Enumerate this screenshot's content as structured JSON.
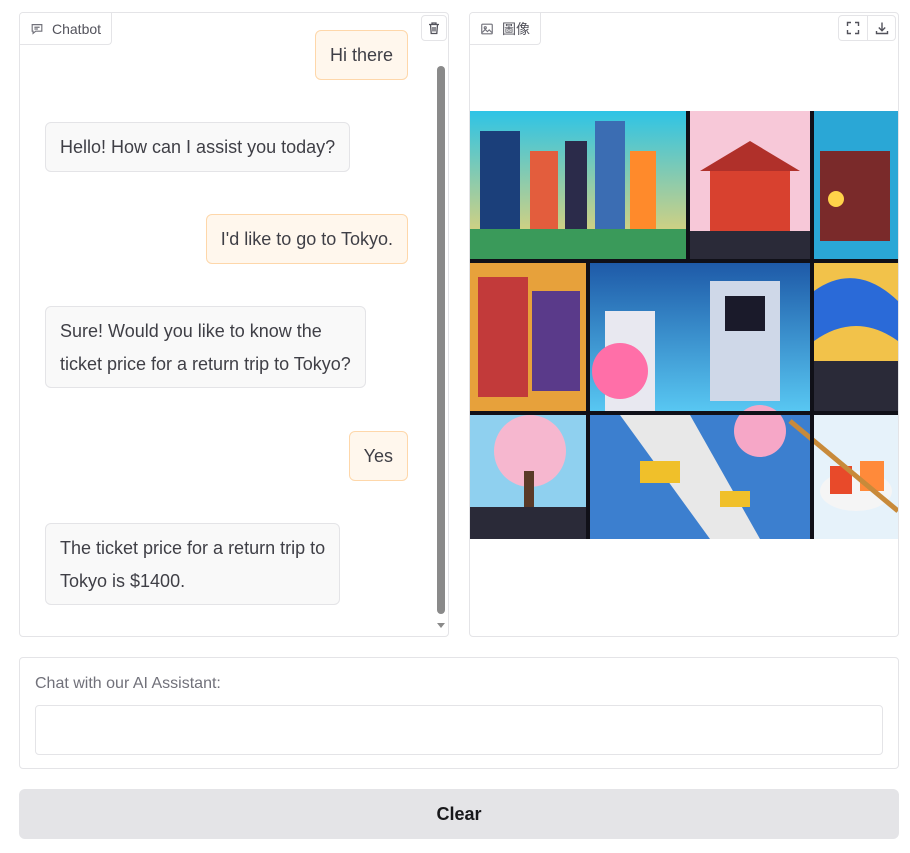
{
  "chatbot": {
    "label": "Chatbot",
    "messages": [
      {
        "role": "user",
        "text": "Hi there"
      },
      {
        "role": "bot",
        "text": "Hello! How can I assist you today?"
      },
      {
        "role": "user",
        "text": "I'd like to go to Tokyo."
      },
      {
        "role": "bot",
        "lines": [
          "Sure! Would you like to know the",
          "ticket price for a return trip to Tokyo?"
        ]
      },
      {
        "role": "user",
        "text": "Yes"
      },
      {
        "role": "bot",
        "lines": [
          "The ticket price for a return trip to",
          "Tokyo is $1400."
        ]
      }
    ],
    "icons": {
      "label_icon": "chat-icon",
      "clear_icon": "trash-icon"
    }
  },
  "image_panel": {
    "label": "圖像",
    "icons": {
      "label_icon": "image-icon",
      "fullscreen": "fullscreen-icon",
      "download": "download-icon"
    }
  },
  "input": {
    "label": "Chat with our AI Assistant:",
    "value": "",
    "placeholder": ""
  },
  "clear_button": {
    "label": "Clear"
  },
  "colors": {
    "user_bubble": "#fff7ed",
    "user_border": "#fed7aa",
    "bot_bubble": "#f9f9f9",
    "border": "#e4e4e7",
    "button": "#e4e4e7"
  }
}
